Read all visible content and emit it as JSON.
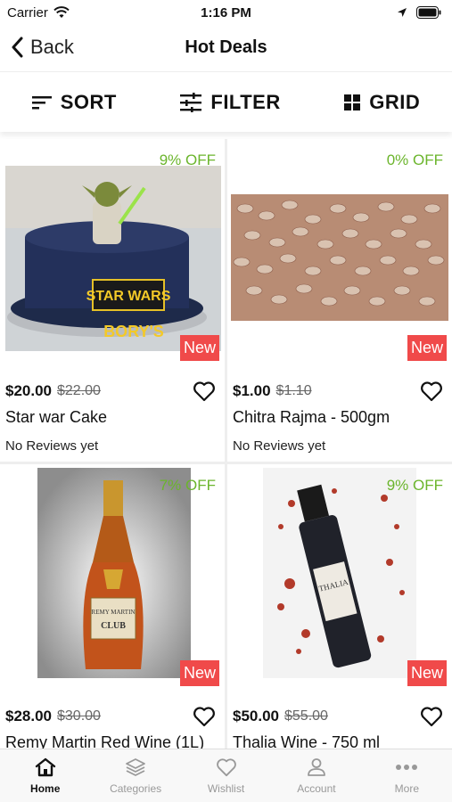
{
  "status_bar": {
    "carrier": "Carrier",
    "time": "1:16 PM"
  },
  "nav": {
    "back_label": "Back",
    "title": "Hot Deals"
  },
  "toolbar": {
    "sort_label": "SORT",
    "filter_label": "FILTER",
    "grid_label": "GRID"
  },
  "products": [
    {
      "discount": "9% OFF",
      "badge": "New",
      "price": "$20.00",
      "old_price": "$22.00",
      "title": "Star war Cake",
      "reviews": "No Reviews yet"
    },
    {
      "discount": "0% OFF",
      "badge": "New",
      "price": "$1.00",
      "old_price": "$1.10",
      "title": "Chitra Rajma - 500gm",
      "reviews": "No Reviews yet"
    },
    {
      "discount": "7% OFF",
      "badge": "New",
      "price": "$28.00",
      "old_price": "$30.00",
      "title": "Remy Martin Red Wine (1L)",
      "reviews": ""
    },
    {
      "discount": "9% OFF",
      "badge": "New",
      "price": "$50.00",
      "old_price": "$55.00",
      "title": "Thalia Wine - 750 ml",
      "reviews": ""
    }
  ],
  "tabs": [
    {
      "label": "Home",
      "icon": "home-icon",
      "active": true
    },
    {
      "label": "Categories",
      "icon": "layers-icon",
      "active": false
    },
    {
      "label": "Wishlist",
      "icon": "heart-icon",
      "active": false
    },
    {
      "label": "Account",
      "icon": "user-icon",
      "active": false
    },
    {
      "label": "More",
      "icon": "more-icon",
      "active": false
    }
  ],
  "colors": {
    "discount": "#6bb52c",
    "badge": "#f04a4a"
  },
  "image_labels": {
    "cake_brand": "STAR WARS",
    "cake_name": "BORY'S",
    "bottle_brand": "REMY MARTIN",
    "bottle_line": "CLUB",
    "wine_brand": "THALIA"
  }
}
